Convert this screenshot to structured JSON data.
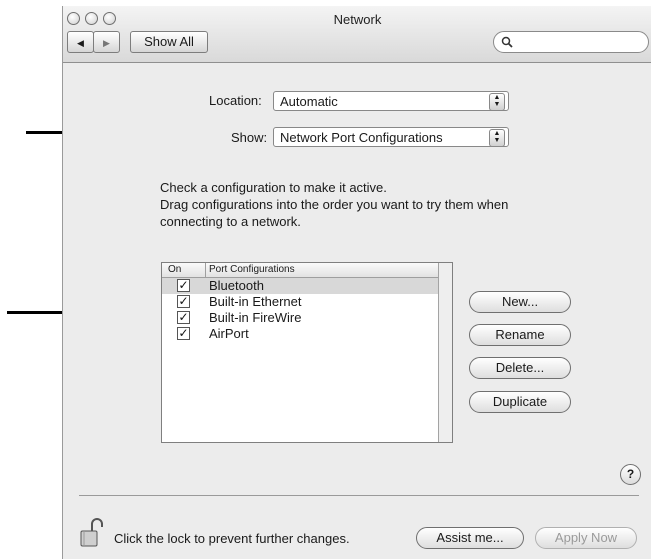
{
  "window": {
    "title": "Network"
  },
  "toolbar": {
    "show_all_label": "Show All",
    "back_icon": "back-arrow-icon",
    "forward_icon": "forward-arrow-icon",
    "search_placeholder": ""
  },
  "location": {
    "label": "Location:",
    "value": "Automatic"
  },
  "show": {
    "label": "Show:",
    "value": "Network Port Configurations"
  },
  "instructions": {
    "line1": "Check a configuration to make it active.",
    "line2": "Drag configurations into the order you want to try them when",
    "line3": "connecting to a network."
  },
  "table": {
    "headers": {
      "on": "On",
      "port": "Port Configurations"
    },
    "rows": [
      {
        "name": "Bluetooth",
        "checked": true,
        "selected": true
      },
      {
        "name": "Built-in Ethernet",
        "checked": true,
        "selected": false
      },
      {
        "name": "Built-in FireWire",
        "checked": true,
        "selected": false
      },
      {
        "name": "AirPort",
        "checked": true,
        "selected": false
      }
    ]
  },
  "buttons": {
    "new": "New...",
    "rename": "Rename",
    "delete": "Delete...",
    "duplicate": "Duplicate"
  },
  "help": "?",
  "footer": {
    "lock_text": "Click the lock to prevent further changes.",
    "assist": "Assist me...",
    "apply": "Apply Now"
  }
}
